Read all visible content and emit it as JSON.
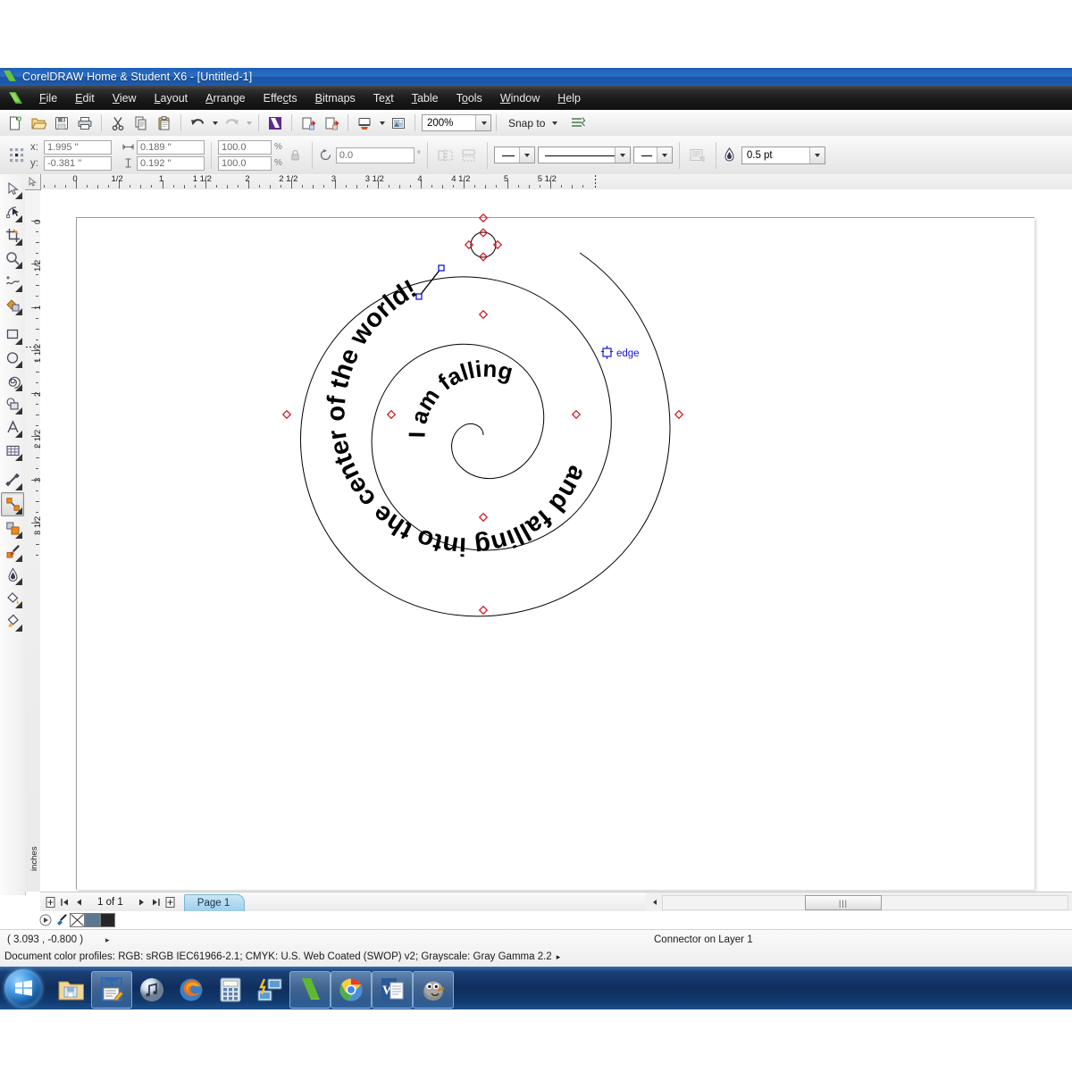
{
  "window": {
    "title": "CorelDRAW Home & Student X6 - [Untitled-1]",
    "app_icon": "coreldraw-logo-icon"
  },
  "menubar": {
    "items": [
      {
        "label": "File",
        "accel": "F"
      },
      {
        "label": "Edit",
        "accel": "E"
      },
      {
        "label": "View",
        "accel": "V"
      },
      {
        "label": "Layout",
        "accel": "L"
      },
      {
        "label": "Arrange",
        "accel": "A"
      },
      {
        "label": "Effects",
        "accel": "c"
      },
      {
        "label": "Bitmaps",
        "accel": "B"
      },
      {
        "label": "Text",
        "accel": "x"
      },
      {
        "label": "Table",
        "accel": "T"
      },
      {
        "label": "Tools",
        "accel": "o"
      },
      {
        "label": "Window",
        "accel": "W"
      },
      {
        "label": "Help",
        "accel": "H"
      }
    ]
  },
  "toolbar": {
    "new_label": "New",
    "open_label": "Open",
    "save_label": "Save",
    "print_label": "Print",
    "cut_label": "Cut",
    "copy_label": "Copy",
    "paste_label": "Paste",
    "undo_label": "Undo",
    "redo_label": "Redo",
    "import_label": "Import",
    "export_label": "Export",
    "publish_pdf_label": "Publish to PDF",
    "launch_label": "Application Launcher",
    "zoom_level": "200%",
    "snap_to_label": "Snap to",
    "options_label": "Options"
  },
  "propertybar": {
    "x_label": "x:",
    "y_label": "y:",
    "x_value": "1.995 \"",
    "y_value": "-0.381 \"",
    "width_value": "0.189 \"",
    "height_value": "0.192 \"",
    "scale_h": "100.0",
    "scale_v": "100.0",
    "percent_symbol": "%",
    "rotation_value": "0.0",
    "degree_symbol": "°",
    "outline_width": "0.5 pt",
    "lock_ratio_name": "lock-ratio-icon",
    "mirror_label": "Mirror",
    "wrap_text_label": "Wrap paragraph text"
  },
  "rulers": {
    "unit": "inches",
    "h_labels": [
      "0",
      "1/2",
      "1",
      "1 1/2",
      "2",
      "2 1/2",
      "3",
      "3 1/2",
      "4",
      "4 1/2",
      "5",
      "5 1/2"
    ],
    "v_labels": [
      "0",
      "1/2",
      "1",
      "1 1/2",
      "2",
      "2 1/2",
      "3",
      "3 1/2"
    ]
  },
  "toolbox": {
    "tools": [
      {
        "name": "pick-tool",
        "active": false
      },
      {
        "name": "shape-tool",
        "active": false
      },
      {
        "name": "crop-tool",
        "active": false
      },
      {
        "name": "zoom-tool",
        "active": false
      },
      {
        "name": "freehand-tool",
        "active": false
      },
      {
        "name": "smart-fill-tool",
        "active": false
      },
      {
        "name": "rectangle-tool",
        "active": false
      },
      {
        "name": "ellipse-tool",
        "active": false
      },
      {
        "name": "polygon-spiral-tool",
        "active": false
      },
      {
        "name": "basic-shapes-tool",
        "active": false
      },
      {
        "name": "text-tool",
        "active": false
      },
      {
        "name": "table-tool",
        "active": false
      },
      {
        "name": "dimension-tool",
        "active": false
      },
      {
        "name": "connector-tool",
        "active": true
      },
      {
        "name": "blend-tool",
        "active": false
      },
      {
        "name": "color-eyedropper-tool",
        "active": false
      },
      {
        "name": "outline-tool",
        "active": false
      },
      {
        "name": "fill-tool",
        "active": false
      },
      {
        "name": "interactive-fill-tool",
        "active": false
      }
    ]
  },
  "canvas": {
    "artwork_text": "I am falling and falling into the center of the world!",
    "snap_label": "edge",
    "snap_color": "#1414dc",
    "node_color": "#d01020",
    "stroke_color": "#000000"
  },
  "pagenav": {
    "add_page_start_label": "Add page before",
    "first_label": "First page",
    "prev_label": "Previous page",
    "count_label": "1 of 1",
    "next_label": "Next page",
    "last_label": "Last page",
    "add_page_end_label": "Add page after",
    "page_tab_label": "Page 1"
  },
  "colorbar": {
    "none_swatch_label": "No color",
    "swatches": [
      "#5c7792",
      "#262626"
    ],
    "scroll_label": "Scroll palette",
    "picker_label": "Color picker"
  },
  "statusbar": {
    "coordinates": "( 3.093 , -0.800 )",
    "coord_arrow": "▸",
    "object_info": "Connector on Layer 1",
    "color_profiles": "Document color profiles: RGB: sRGB IEC61966-2.1; CMYK: U.S. Web Coated (SWOP) v2; Grayscale: Gray Gamma 2.2",
    "profiles_arrow": "▸"
  },
  "taskbar": {
    "start_label": "Start",
    "items": [
      {
        "name": "windows-explorer-icon",
        "label": "Windows Explorer",
        "open": false
      },
      {
        "name": "notepad-editor-icon",
        "label": "Text Editor",
        "open": true
      },
      {
        "name": "itunes-icon",
        "label": "iTunes",
        "open": false
      },
      {
        "name": "firefox-icon",
        "label": "Mozilla Firefox",
        "open": false
      },
      {
        "name": "calculator-icon",
        "label": "Calculator",
        "open": false
      },
      {
        "name": "remote-desktop-icon",
        "label": "Remote Desktop",
        "open": false
      },
      {
        "name": "coreldraw-icon",
        "label": "CorelDRAW",
        "open": true
      },
      {
        "name": "google-chrome-icon",
        "label": "Google Chrome",
        "open": true
      },
      {
        "name": "microsoft-word-icon",
        "label": "Microsoft Word",
        "open": true
      },
      {
        "name": "gimp-icon",
        "label": "GIMP",
        "open": true
      }
    ]
  }
}
